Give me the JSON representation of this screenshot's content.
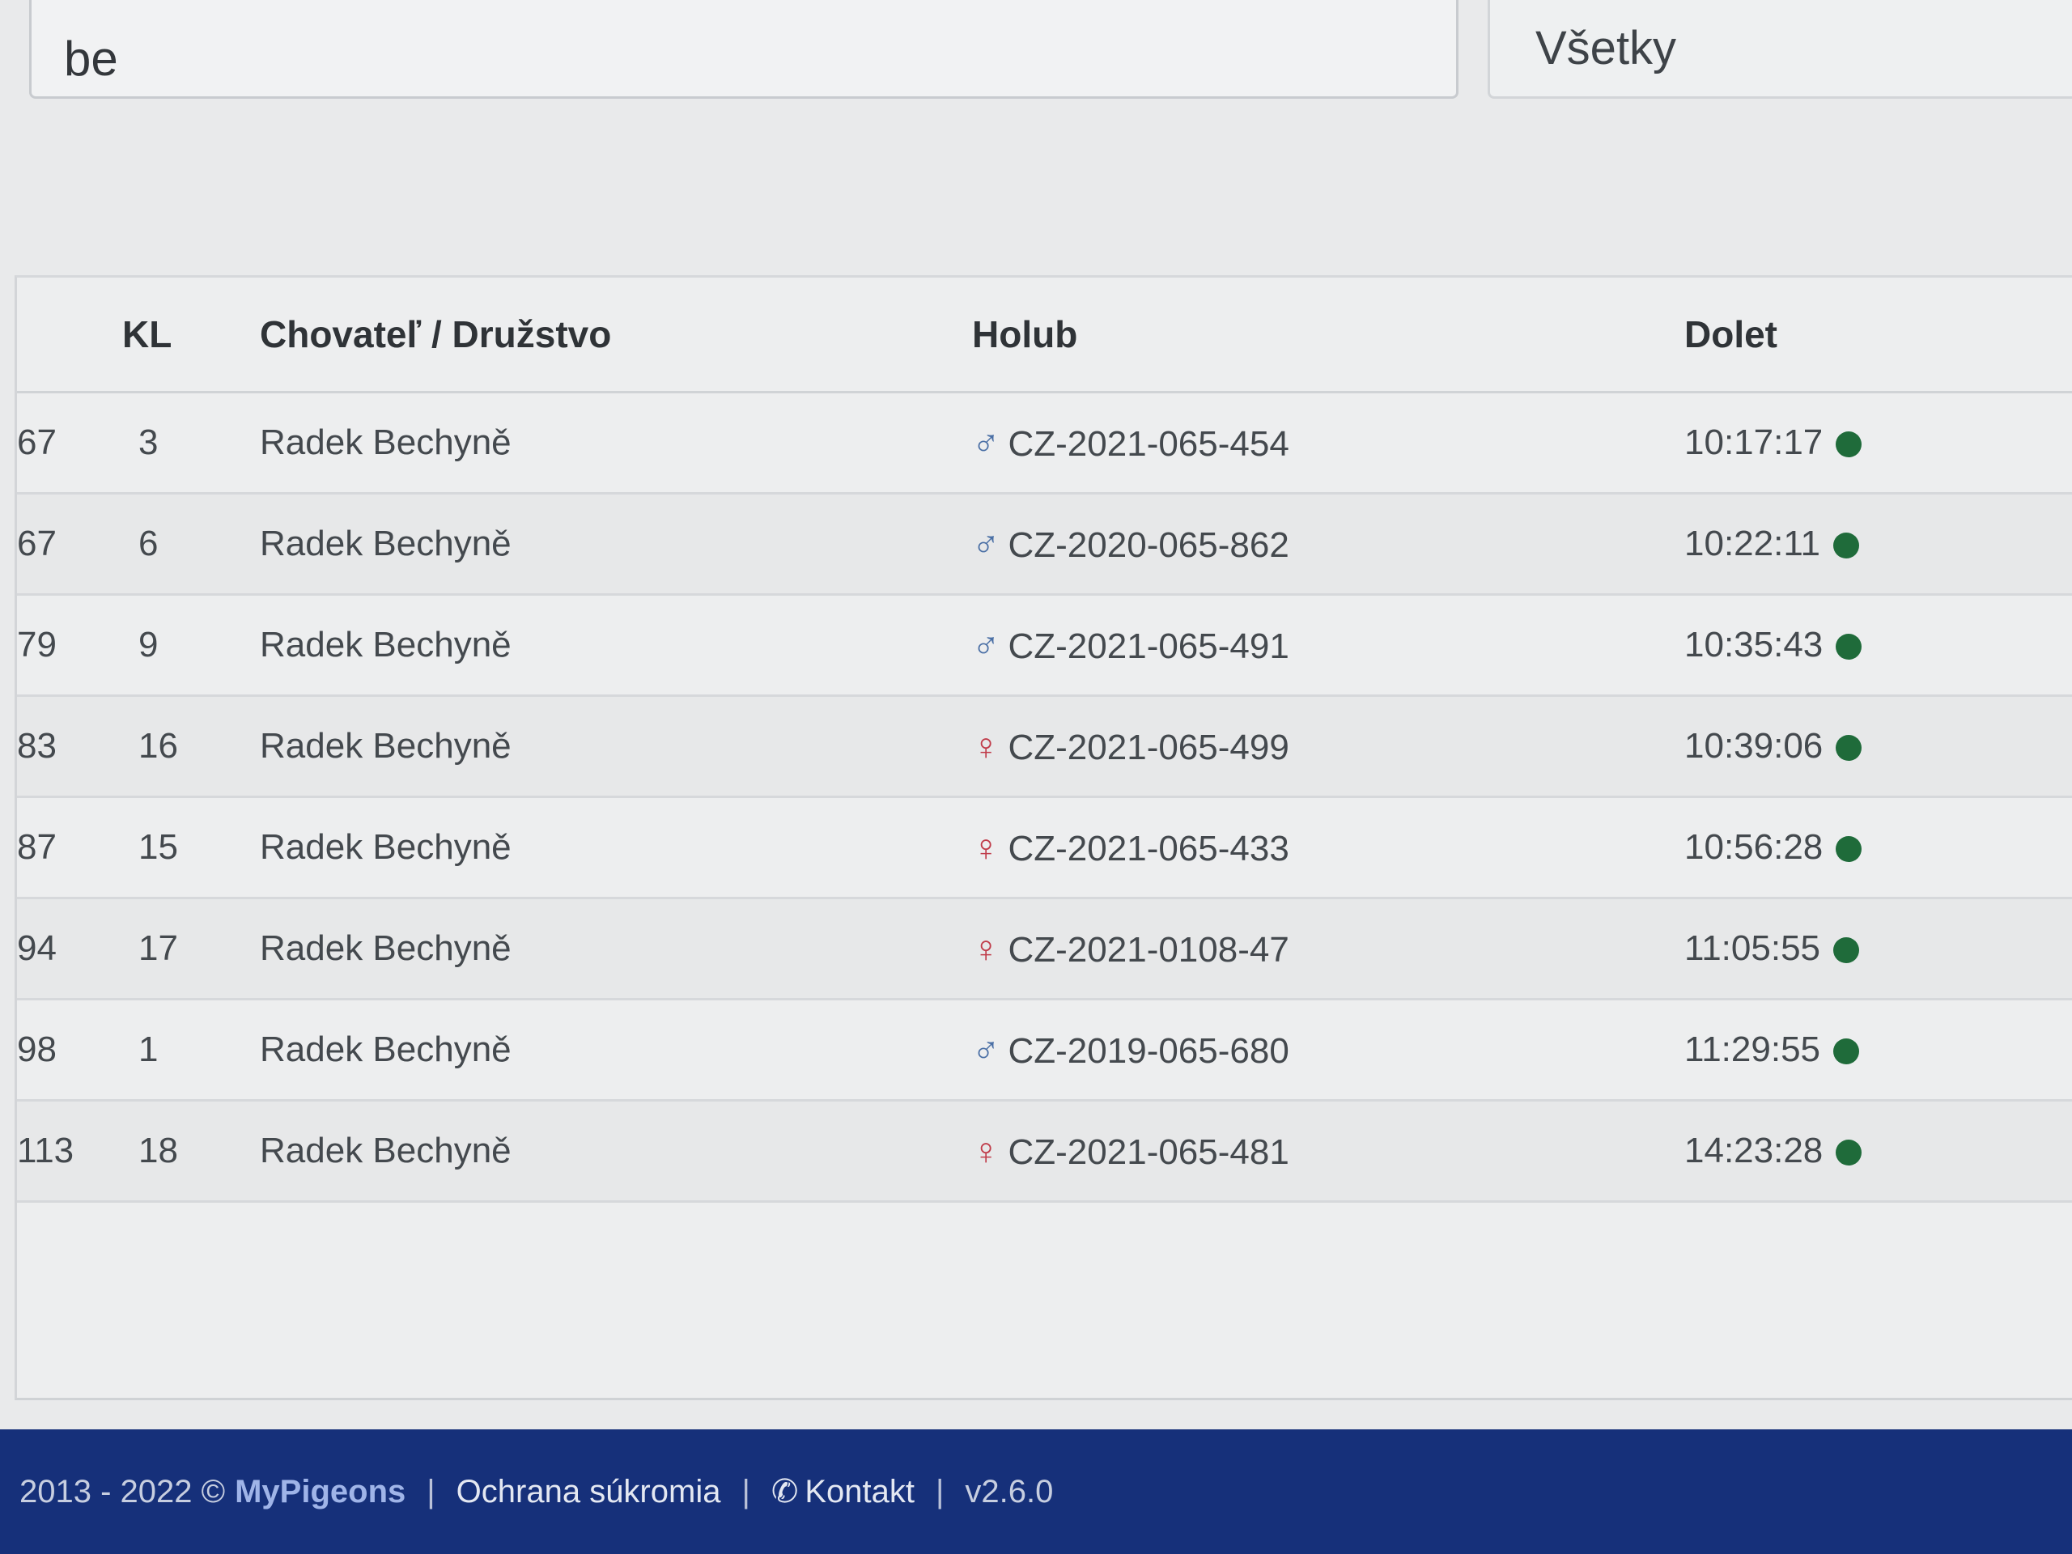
{
  "search": {
    "value": "be",
    "filter_selected": "Všetky"
  },
  "table": {
    "headers": {
      "rank": "",
      "kl": "KL",
      "breeder": "Chovateľ / Družstvo",
      "pigeon": "Holub",
      "arrival": "Dolet"
    },
    "rows": [
      {
        "rank": "67",
        "kl": "3",
        "breeder": "Radek Bechyně",
        "sex": "male",
        "pigeon": "CZ-2021-065-454",
        "arrival": "10:17:17"
      },
      {
        "rank": "67",
        "kl": "6",
        "breeder": "Radek Bechyně",
        "sex": "male",
        "pigeon": "CZ-2020-065-862",
        "arrival": "10:22:11"
      },
      {
        "rank": "79",
        "kl": "9",
        "breeder": "Radek Bechyně",
        "sex": "male",
        "pigeon": "CZ-2021-065-491",
        "arrival": "10:35:43"
      },
      {
        "rank": "83",
        "kl": "16",
        "breeder": "Radek Bechyně",
        "sex": "female",
        "pigeon": "CZ-2021-065-499",
        "arrival": "10:39:06"
      },
      {
        "rank": "87",
        "kl": "15",
        "breeder": "Radek Bechyně",
        "sex": "female",
        "pigeon": "CZ-2021-065-433",
        "arrival": "10:56:28"
      },
      {
        "rank": "94",
        "kl": "17",
        "breeder": "Radek Bechyně",
        "sex": "female",
        "pigeon": "CZ-2021-0108-47",
        "arrival": "11:05:55"
      },
      {
        "rank": "98",
        "kl": "1",
        "breeder": "Radek Bechyně",
        "sex": "male",
        "pigeon": "CZ-2019-065-680",
        "arrival": "11:29:55"
      },
      {
        "rank": "113",
        "kl": "18",
        "breeder": "Radek Bechyně",
        "sex": "female",
        "pigeon": "CZ-2021-065-481",
        "arrival": "14:23:28"
      }
    ]
  },
  "icons": {
    "male": "male-sign-icon",
    "female": "female-sign-icon",
    "status": "status-dot-icon",
    "phone": "phone-icon"
  },
  "colors": {
    "male": "#4a6fa5",
    "female": "#c03c4a",
    "status_dot": "#1f6b3a",
    "footer_bg": "#16307a"
  },
  "footer": {
    "copyright": "2013 - 2022 ©",
    "brand": "MyPigeons",
    "privacy": "Ochrana súkromia",
    "contact": "Kontakt",
    "version": "v2.6.0"
  }
}
